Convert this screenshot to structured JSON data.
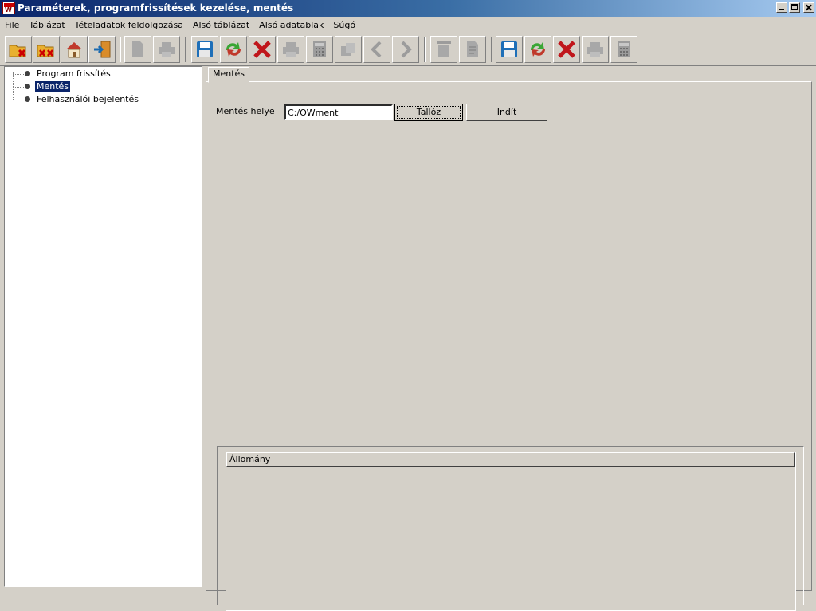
{
  "window": {
    "title": "Paraméterek, programfrissítések kezelése, mentés"
  },
  "menu": [
    "File",
    "Táblázat",
    "Tételadatok feldolgozása",
    "Alsó táblázat",
    "Alsó adatablak",
    "Súgó"
  ],
  "toolbar": {
    "buttons": [
      "folder-delete-icon",
      "folder-delete-all-icon",
      "home-icon",
      "exit-door-icon",
      "new-document-icon",
      "print-icon",
      "save-icon",
      "refresh-icon",
      "delete-icon",
      "print-icon",
      "calculator-icon",
      "copy-icon",
      "previous-icon",
      "next-icon",
      "document-icon",
      "document-edit-icon",
      "save-icon",
      "refresh-icon",
      "delete-icon",
      "print-icon",
      "calculator-icon"
    ]
  },
  "tree": {
    "items": [
      {
        "label": "Program frissítés"
      },
      {
        "label": "Mentés"
      },
      {
        "label": "Felhasználói bejelentés"
      }
    ]
  },
  "tabs": {
    "active": "Mentés"
  },
  "form": {
    "label": "Mentés helye",
    "path_value": "C:/OWment",
    "browse_label": "Tallóz",
    "start_label": "Indít"
  },
  "list": {
    "header": "Állomány"
  }
}
